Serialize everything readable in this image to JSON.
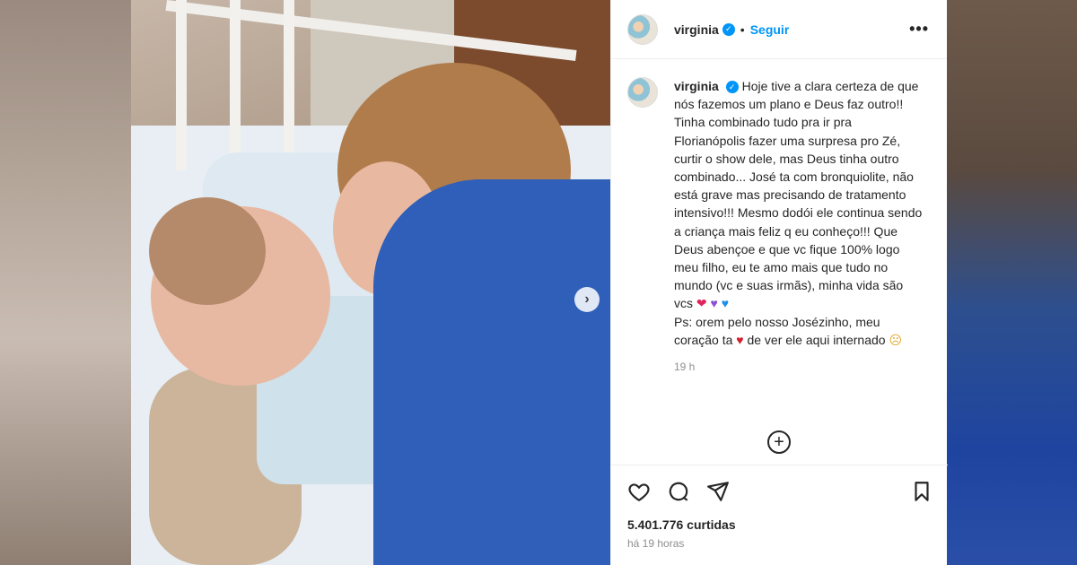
{
  "post": {
    "username": "virginia",
    "follow_label": "Seguir",
    "more_label": "•••",
    "caption_text": "Hoje tive a clara certeza de que nós fazemos um plano e Deus faz outro!! Tinha combinado tudo pra ir pra Florianópolis fazer uma surpresa pro Zé, curtir o show dele, mas Deus tinha outro combinado... José ta com bronquiolite, não está grave mas precisando de tratamento intensivo!!! Mesmo dodói ele continua sendo a criança mais feliz q eu conheço!!! Que Deus abençoe e que vc fique 100% logo meu filho, eu te amo mais que tudo no mundo (vc e suas irmãs), minha vida são vcs",
    "emoji_1": "❤",
    "emoji_2": "♥",
    "emoji_3": "♥",
    "ps_text": "Ps: orem pelo nosso Josézinho, meu coração ta",
    "emoji_4": "♥",
    "ps_text_end": "de ver ele aqui internado",
    "emoji_5": "☹",
    "caption_time": "19 h",
    "likes": "5.401.776 curtidas",
    "posted_time": "há 19 horas"
  },
  "icons": {
    "add_comment": "+",
    "next": "›",
    "verified": "✓"
  }
}
